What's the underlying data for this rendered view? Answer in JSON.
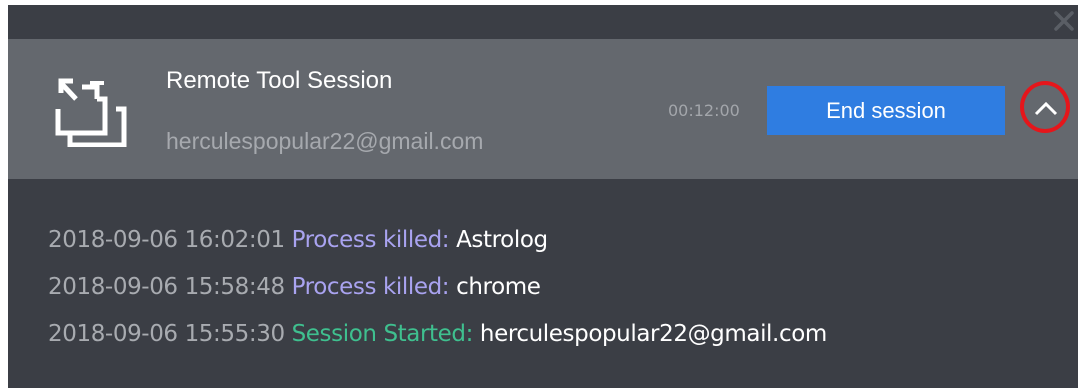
{
  "window": {
    "close_icon": "close-icon"
  },
  "session": {
    "icon": "remote-session-icon",
    "title": "Remote Tool Session",
    "user": "herculespopular22@gmail.com",
    "timer": "00:12:00",
    "end_button_label": "End session",
    "collapse_icon": "chevron-up-icon"
  },
  "colors": {
    "panel_bg": "#3b3e45",
    "header_bg": "#64686e",
    "button_blue": "#2f7de1",
    "highlight_red": "#e5161b",
    "event_killed": "#a9a3f0",
    "event_started": "#3fc08f"
  },
  "log": [
    {
      "timestamp": "2018-09-06 16:02:01",
      "event": "Process killed:",
      "detail": "Astrolog"
    },
    {
      "timestamp": "2018-09-06 15:58:48",
      "event": "Process killed:",
      "detail": "chrome"
    },
    {
      "timestamp": "2018-09-06 15:55:30",
      "event": "Session Started:",
      "detail": "herculespopular22@gmail.com"
    }
  ]
}
